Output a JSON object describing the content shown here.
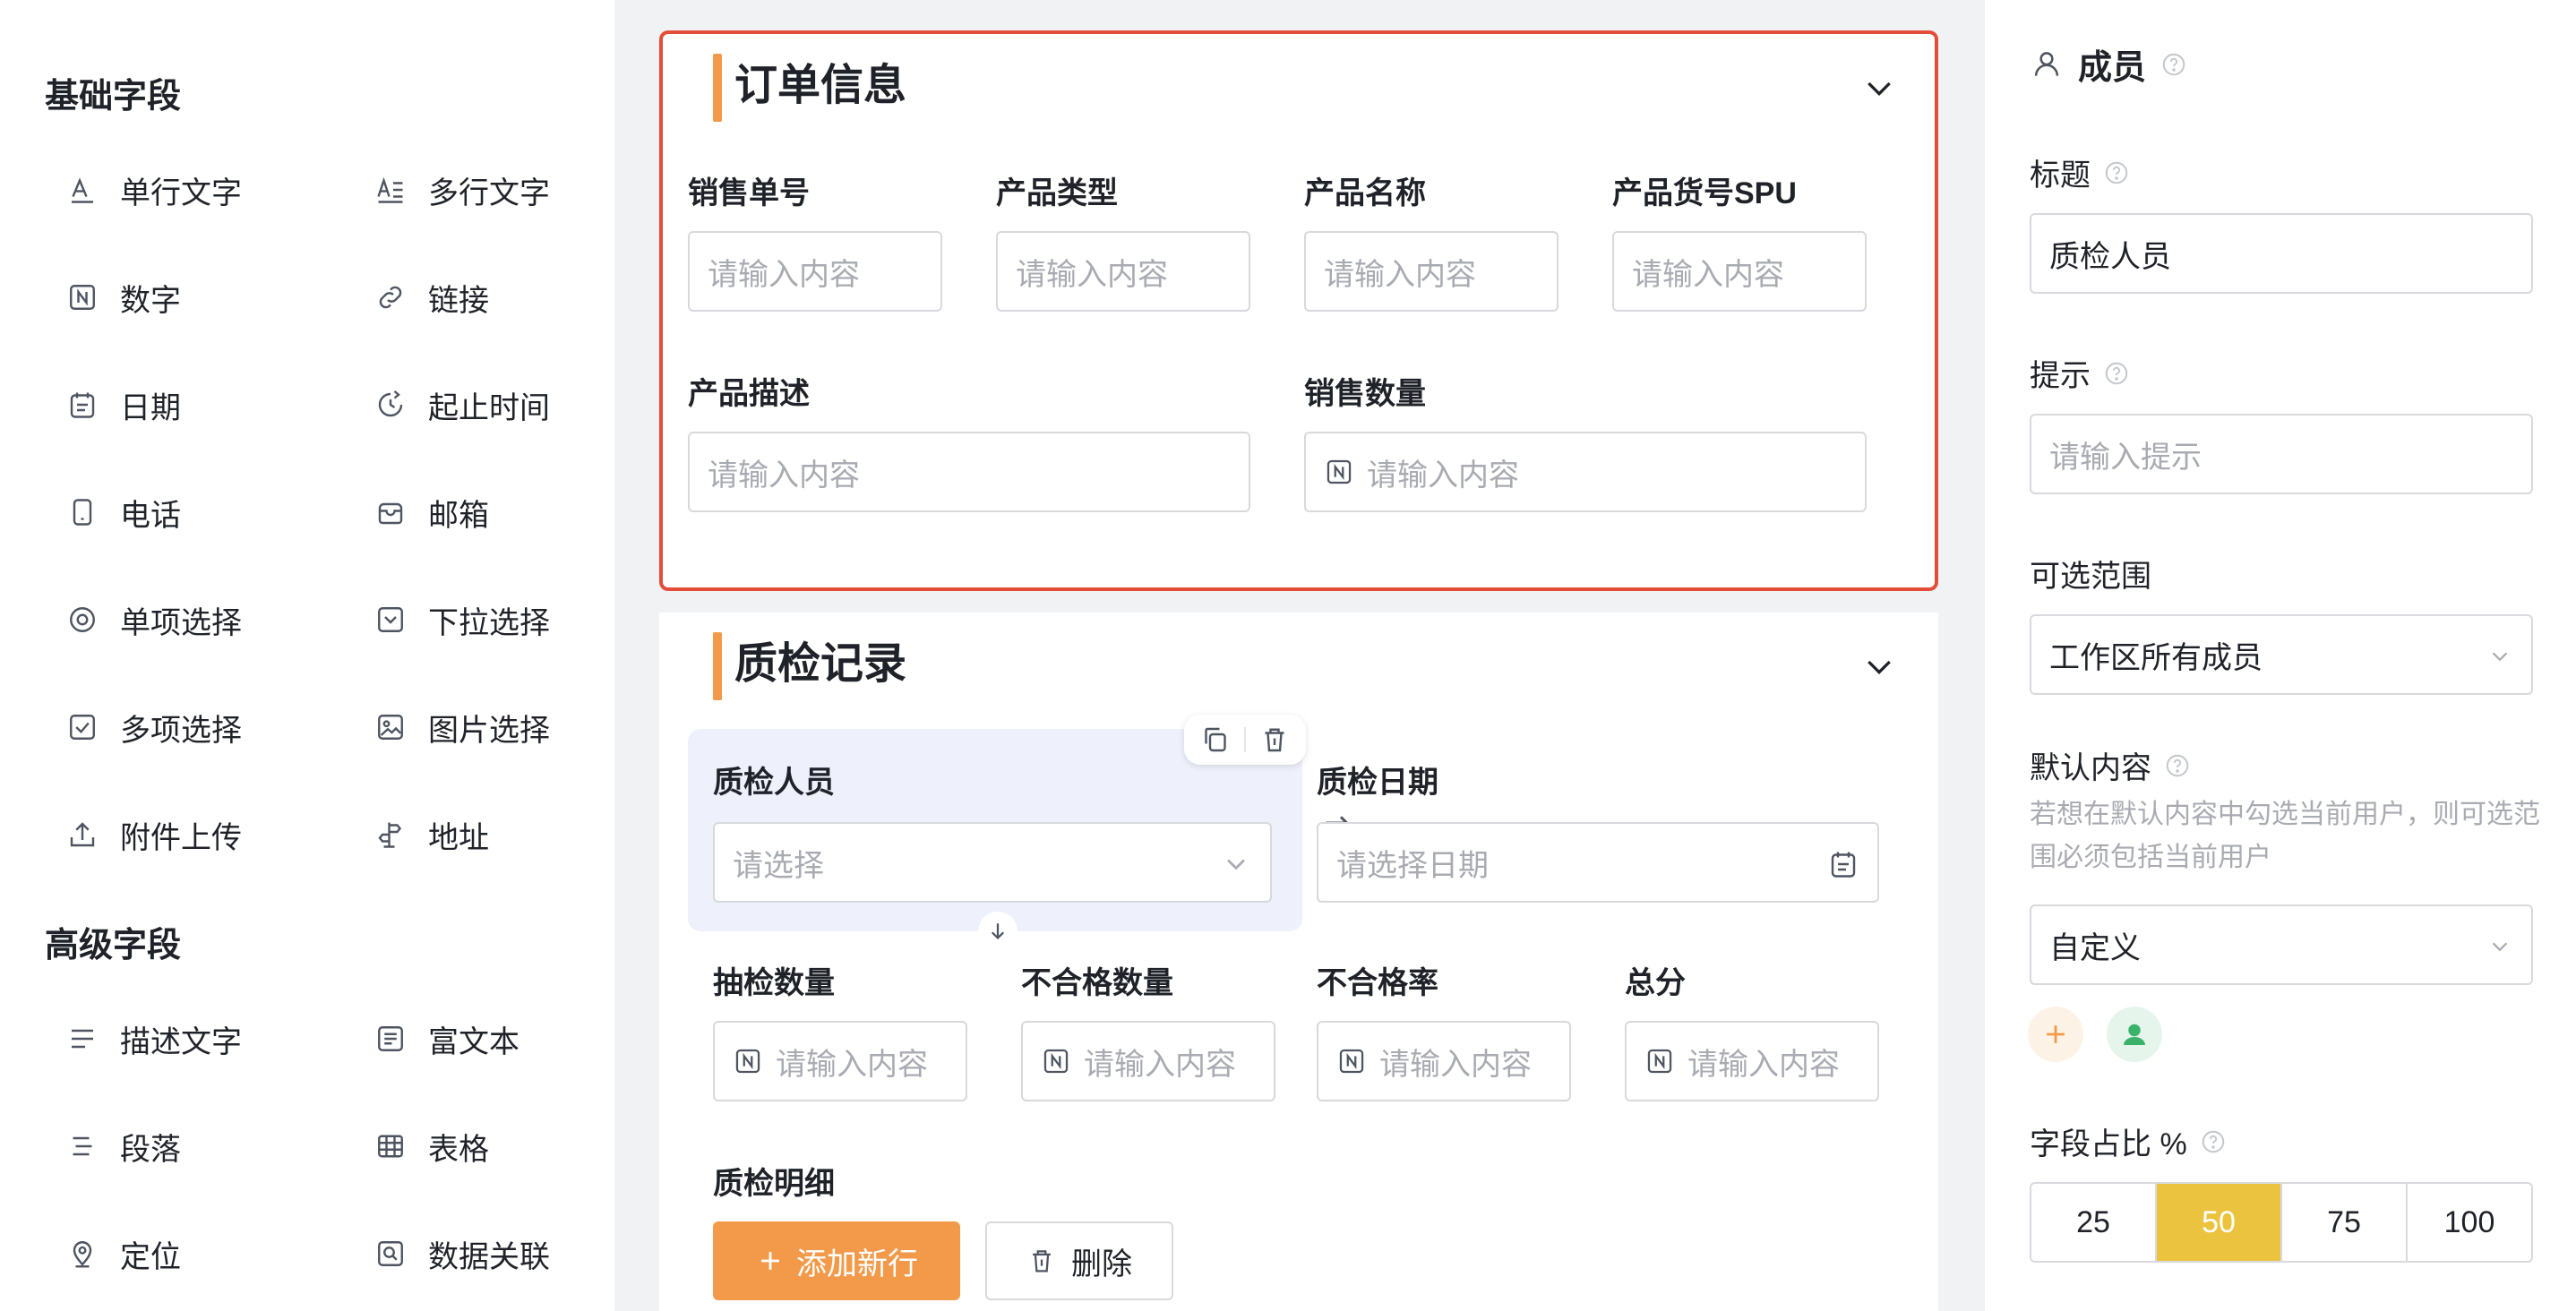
{
  "palette": {
    "basic_title": "基础字段",
    "advanced_title": "高级字段",
    "basic_items": [
      {
        "label": "单行文字",
        "icon": "single-line-text-icon"
      },
      {
        "label": "多行文字",
        "icon": "multi-line-text-icon"
      },
      {
        "label": "数字",
        "icon": "number-icon"
      },
      {
        "label": "链接",
        "icon": "link-icon"
      },
      {
        "label": "日期",
        "icon": "calendar-icon"
      },
      {
        "label": "起止时间",
        "icon": "time-range-icon"
      },
      {
        "label": "电话",
        "icon": "phone-icon"
      },
      {
        "label": "邮箱",
        "icon": "mailbox-icon"
      },
      {
        "label": "单项选择",
        "icon": "radio-icon"
      },
      {
        "label": "下拉选择",
        "icon": "dropdown-icon"
      },
      {
        "label": "多项选择",
        "icon": "checkbox-icon"
      },
      {
        "label": "图片选择",
        "icon": "image-icon"
      },
      {
        "label": "附件上传",
        "icon": "upload-icon"
      },
      {
        "label": "地址",
        "icon": "address-icon"
      }
    ],
    "advanced_items": [
      {
        "label": "描述文字",
        "icon": "description-icon"
      },
      {
        "label": "富文本",
        "icon": "rich-text-icon"
      },
      {
        "label": "段落",
        "icon": "paragraph-icon"
      },
      {
        "label": "表格",
        "icon": "table-icon"
      },
      {
        "label": "定位",
        "icon": "location-icon"
      },
      {
        "label": "数据关联",
        "icon": "data-link-icon"
      }
    ]
  },
  "canvas": {
    "order_section": {
      "title": "订单信息",
      "fields": [
        {
          "label": "销售单号",
          "placeholder": "请输入内容"
        },
        {
          "label": "产品类型",
          "placeholder": "请输入内容"
        },
        {
          "label": "产品名称",
          "placeholder": "请输入内容"
        },
        {
          "label": "产品货号SPU",
          "placeholder": "请输入内容"
        },
        {
          "label": "产品描述",
          "placeholder": "请输入内容"
        },
        {
          "label": "销售数量",
          "placeholder": "请输入内容"
        }
      ]
    },
    "qc_section": {
      "title": "质检记录",
      "fields": [
        {
          "label": "质检人员",
          "placeholder": "请选择"
        },
        {
          "label": "质检日期",
          "placeholder": "请选择日期"
        },
        {
          "label": "抽检数量",
          "placeholder": "请输入内容"
        },
        {
          "label": "不合格数量",
          "placeholder": "请输入内容"
        },
        {
          "label": "不合格率",
          "placeholder": "请输入内容"
        },
        {
          "label": "总分",
          "placeholder": "请输入内容"
        }
      ],
      "detail_label": "质检明细",
      "add_row_label": "添加新行",
      "delete_label": "删除"
    }
  },
  "props": {
    "header": "成员",
    "title_label": "标题",
    "title_value": "质检人员",
    "hint_label": "提示",
    "hint_placeholder": "请输入提示",
    "range_label": "可选范围",
    "range_value": "工作区所有成员",
    "default_label": "默认内容",
    "default_hint": "若想在默认内容中勾选当前用户，则可选范围必须包括当前用户",
    "default_value": "自定义",
    "width_label": "字段占比 %",
    "width_options": [
      "25",
      "50",
      "75",
      "100"
    ],
    "width_selected": "50"
  },
  "colors": {
    "accent": "#f29a4a",
    "selected_border": "#e34d3a",
    "segment_active": "#ebc33f",
    "avatar_green": "#3bb26a"
  }
}
